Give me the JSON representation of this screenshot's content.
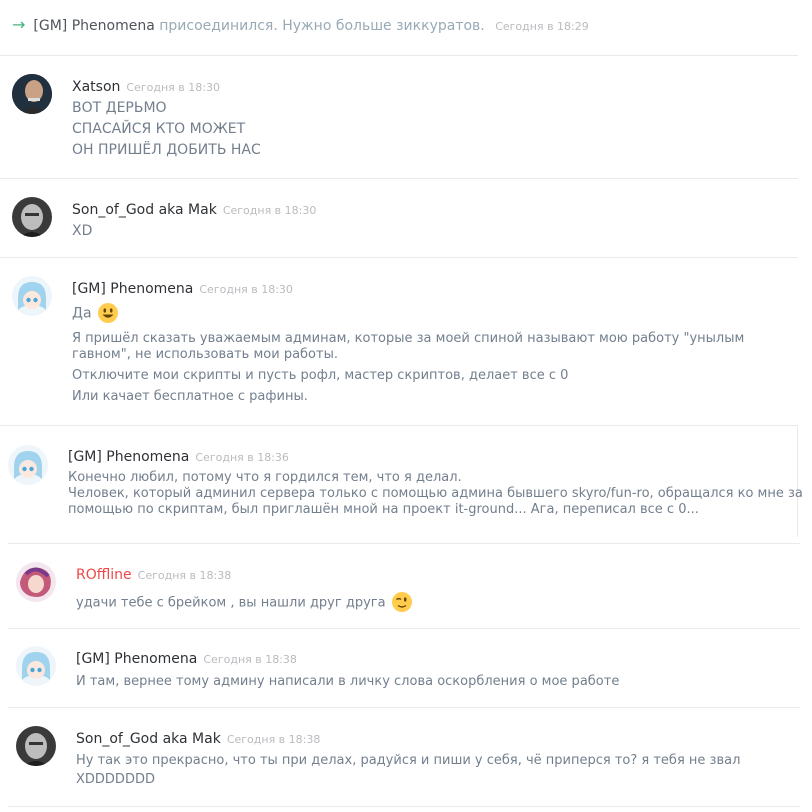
{
  "system": {
    "name": "[GM] Phenomena",
    "text": "присоединился. Нужно больше зиккуратов.",
    "time": "Сегодня в 18:29"
  },
  "messages": [
    {
      "author": "Xatson",
      "time": "Сегодня в 18:30",
      "lines": [
        "ВОТ ДЕРЬМО",
        "СПАСАЙСЯ КТО МОЖЕТ",
        "ОН ПРИШЁЛ ДОБИТЬ НАС"
      ]
    },
    {
      "author": "Son_of_God aka Mak",
      "time": "Сегодня в 18:30",
      "lines": [
        "XD"
      ]
    },
    {
      "author": "[GM] Phenomena",
      "time": "Сегодня в 18:30",
      "lines": [
        "Да",
        "Я пришёл сказать уважаемым админам, которые за моей спиной называют мою работу \"унылым",
        "гавном\", не использовать мои работы.",
        "Отключите мои скрипты и пусть рофл, мастер скриптов, делает все с 0",
        "Или качает бесплатное с рафины."
      ]
    },
    {
      "author": "[GM] Phenomena",
      "time": "Сегодня в 18:36",
      "lines": [
        "Конечно любил, потому что я гордился тем, что я делал.",
        "Человек, который админил сервера только с помощью админа бывшего skyro/fun-ro, обращался ко мне за",
        "помощью по скриптам, был приглашён мной на проект it-ground... Ага, переписал все с 0..."
      ]
    },
    {
      "author": "ROffline",
      "time": "Сегодня в 18:38",
      "author_color": "#f04747",
      "lines": [
        "удачи тебе с брейком , вы нашли друг друга"
      ]
    },
    {
      "author": "[GM] Phenomena",
      "time": "Сегодня в 18:38",
      "lines": [
        "И там, вернее тому админу написали в личку слова оскорбления о мое работе"
      ]
    },
    {
      "author": "Son_of_God aka Mak",
      "time": "Сегодня в 18:38",
      "lines": [
        "Ну так это прекрасно, что ты при делах, радуйся и пиши у себя, чё приперся то? я тебя не звал",
        "XDDDDDDD"
      ]
    }
  ],
  "colors": {
    "accent_join": "#43b581",
    "author": "#2e3136",
    "text": "#737f8d",
    "timestamp": "#b9bbbe",
    "roffline": "#f04747"
  }
}
